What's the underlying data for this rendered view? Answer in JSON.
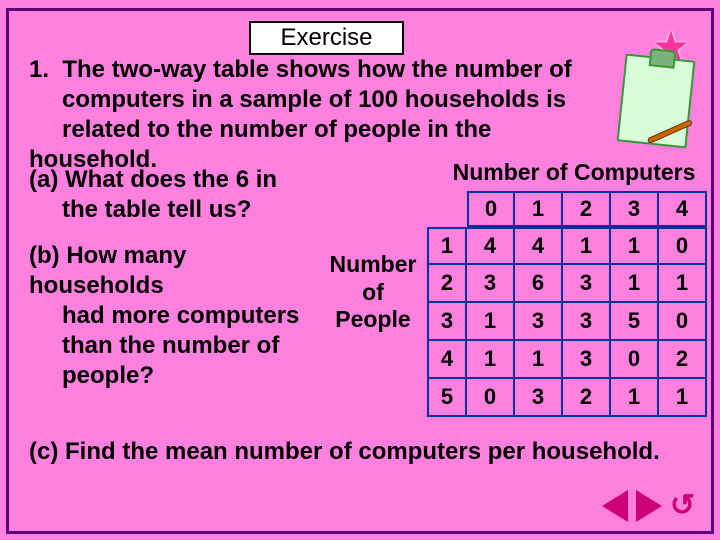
{
  "header": {
    "exercise_label": "Exercise"
  },
  "question": {
    "number": "1.",
    "prompt_line1": "The two-way table shows how the number of",
    "prompt_line2": "computers in a sample of 100 households is",
    "prompt_line3": "related to the number of people in the household.",
    "a_label": "(a)",
    "a_text1": "What does the 6 in",
    "a_text2": "the table tell us?",
    "b_label": "(b)",
    "b_text1": "How many households",
    "b_text2": "had more computers",
    "b_text3": "than the number of",
    "b_text4": "people?",
    "c_label": "(c)",
    "c_text": "Find the mean number of computers per household."
  },
  "table": {
    "col_title": "Number of Computers",
    "row_title_line1": "Number",
    "row_title_line2": "of",
    "row_title_line3": "People",
    "col_headers": [
      "0",
      "1",
      "2",
      "3",
      "4"
    ],
    "row_keys": [
      "1",
      "2",
      "3",
      "4",
      "5"
    ],
    "data": [
      [
        "4",
        "4",
        "1",
        "1",
        "0"
      ],
      [
        "3",
        "6",
        "3",
        "1",
        "1"
      ],
      [
        "1",
        "3",
        "3",
        "5",
        "0"
      ],
      [
        "1",
        "1",
        "3",
        "0",
        "2"
      ],
      [
        "0",
        "3",
        "2",
        "1",
        "1"
      ]
    ]
  },
  "icons": {
    "star": "★",
    "undo": "↺"
  },
  "chart_data": {
    "type": "table",
    "title": "Two-way table: number of computers vs number of people (sample of 100 households)",
    "xlabel": "Number of Computers",
    "ylabel": "Number of People",
    "col_categories": [
      0,
      1,
      2,
      3,
      4
    ],
    "row_categories": [
      1,
      2,
      3,
      4,
      5
    ],
    "values": [
      [
        4,
        4,
        1,
        1,
        0
      ],
      [
        3,
        6,
        3,
        1,
        1
      ],
      [
        1,
        3,
        3,
        5,
        0
      ],
      [
        1,
        1,
        3,
        0,
        2
      ],
      [
        0,
        3,
        2,
        1,
        1
      ]
    ]
  }
}
